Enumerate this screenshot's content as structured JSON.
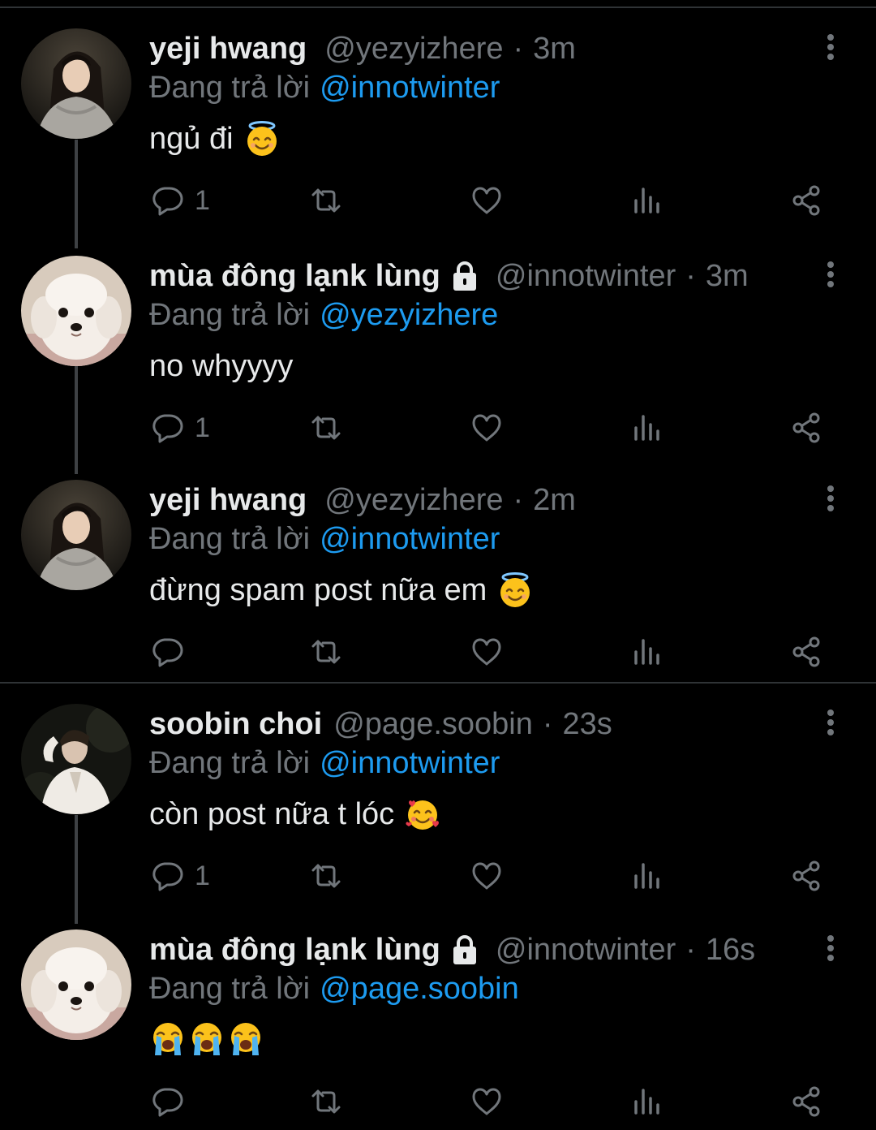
{
  "reply_prefix": "Đang trả lời",
  "colors": {
    "background": "#000000",
    "name": "#e7e9ea",
    "muted": "#71767b",
    "mention": "#1d9bf0"
  },
  "tweets": [
    {
      "name": "yeji hwang",
      "handle": "@yezyizhere",
      "time": "3m",
      "replying_to": "@innotwinter",
      "text": "ngủ đi",
      "emoji": [
        "smiling-face-with-halo"
      ],
      "reply_count": "1",
      "avatar": "woman-portrait",
      "locked": false
    },
    {
      "name": "mùa đông lạnk lùng",
      "handle": "@innotwinter",
      "time": "3m",
      "replying_to": "@yezyizhere",
      "text": "no whyyyy",
      "emoji": [],
      "reply_count": "1",
      "avatar": "white-puppy",
      "locked": true
    },
    {
      "name": "yeji hwang",
      "handle": "@yezyizhere",
      "time": "2m",
      "replying_to": "@innotwinter",
      "text": "đừng spam post nữa em",
      "emoji": [
        "smiling-face-with-halo"
      ],
      "reply_count": "",
      "avatar": "woman-portrait",
      "locked": false
    },
    {
      "name": "soobin choi",
      "handle": "@page.soobin",
      "time": "23s",
      "replying_to": "@innotwinter",
      "text": "còn post nữa t lóc",
      "emoji": [
        "smiling-face-with-hearts"
      ],
      "reply_count": "1",
      "avatar": "man-portrait",
      "locked": false
    },
    {
      "name": "mùa đông lạnk lùng",
      "handle": "@innotwinter",
      "time": "16s",
      "replying_to": "@page.soobin",
      "text": "",
      "emoji": [
        "loudly-crying-face",
        "loudly-crying-face",
        "loudly-crying-face"
      ],
      "reply_count": "",
      "avatar": "white-puppy",
      "locked": true
    }
  ]
}
